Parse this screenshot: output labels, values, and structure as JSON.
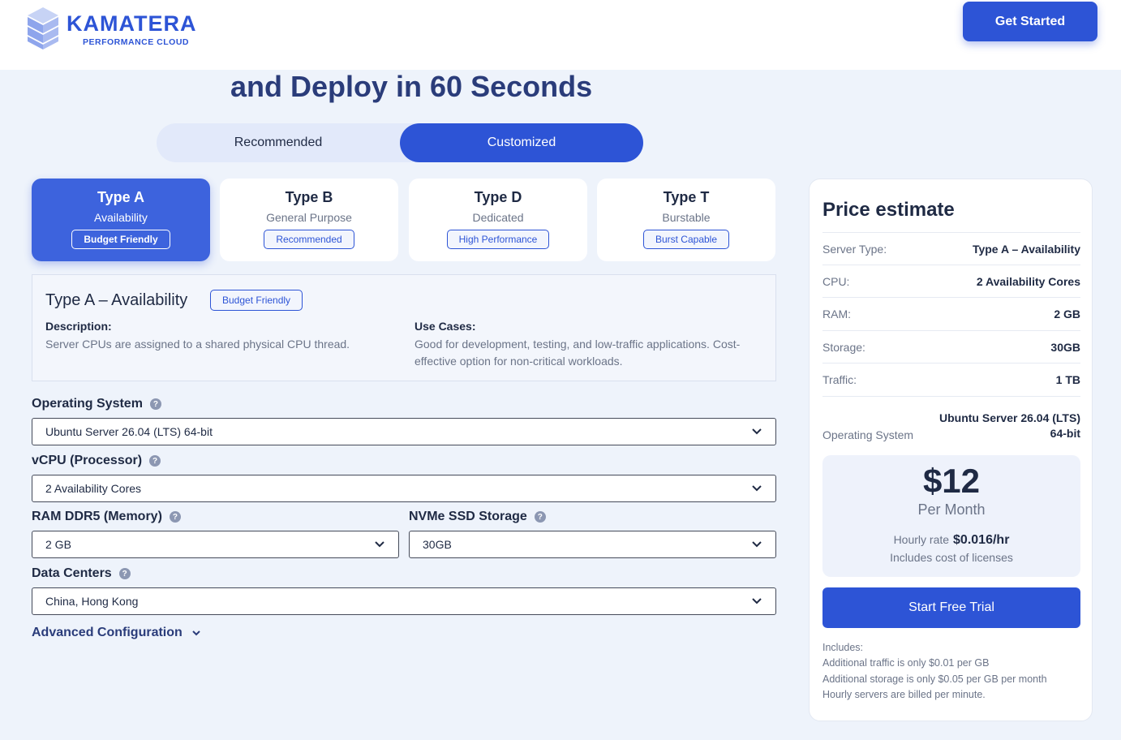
{
  "header": {
    "logo_text": "KAMATERA",
    "logo_sub": "PERFORMANCE CLOUD",
    "get_started": "Get Started"
  },
  "headline": "and Deploy in 60 Seconds",
  "mode_toggle": {
    "recommended": "Recommended",
    "customized": "Customized",
    "selected": "Customized"
  },
  "types": [
    {
      "title": "Type A",
      "subtitle": "Availability",
      "badge": "Budget Friendly",
      "selected": true
    },
    {
      "title": "Type B",
      "subtitle": "General Purpose",
      "badge": "Recommended",
      "selected": false
    },
    {
      "title": "Type D",
      "subtitle": "Dedicated",
      "badge": "High Performance",
      "selected": false
    },
    {
      "title": "Type T",
      "subtitle": "Burstable",
      "badge": "Burst Capable",
      "selected": false
    }
  ],
  "detail": {
    "title": "Type A – Availability",
    "badge": "Budget Friendly",
    "description_label": "Description:",
    "description": "Server CPUs are assigned to a shared physical CPU thread.",
    "use_cases_label": "Use Cases:",
    "use_cases_line1": "Good for development, testing, and low-traffic applications. Cost-",
    "use_cases_line2": "effective option for non-critical workloads."
  },
  "form": {
    "os": {
      "label": "Operating System",
      "value": "Ubuntu Server 26.04 (LTS) 64-bit"
    },
    "vcpu": {
      "label": "vCPU (Processor)",
      "value": "2 Availability Cores"
    },
    "ram": {
      "label": "RAM DDR5 (Memory)",
      "value": "2 GB"
    },
    "storage": {
      "label": "NVMe SSD Storage",
      "value": "30GB"
    },
    "datacenter": {
      "label": "Data Centers",
      "value": "China, Hong Kong"
    },
    "help_glyph": "?",
    "advanced": "Advanced Configuration"
  },
  "price": {
    "title": "Price estimate",
    "rows": [
      {
        "key": "Server Type:",
        "value": "Type A – Availability"
      },
      {
        "key": "CPU:",
        "value": "2 Availability Cores"
      },
      {
        "key": "RAM:",
        "value": "2 GB"
      },
      {
        "key": "Storage:",
        "value": "30GB"
      },
      {
        "key": "Traffic:",
        "value": "1 TB"
      }
    ],
    "os_row": {
      "key": "Operating System",
      "value_line1": "Ubuntu Server 26.04 (LTS)",
      "value_line2": "64-bit"
    },
    "amount": "$12",
    "per": "Per Month",
    "hourly_label": "Hourly rate",
    "hourly_value": "$0.016/hr",
    "licenses": "Includes cost of licenses",
    "trial_button": "Start Free Trial",
    "includes_label": "Includes:",
    "includes": [
      "Additional traffic is only $0.01 per GB",
      "Additional storage is only $0.05 per GB per month",
      "Hourly servers are billed per minute."
    ]
  },
  "colors": {
    "accent": "#2d54d6",
    "background": "#eef3fb"
  }
}
